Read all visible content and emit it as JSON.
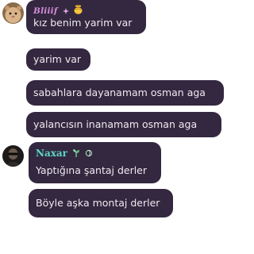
{
  "messages": [
    {
      "sender": "Bliiif",
      "sender_color": "#d88bdc",
      "avatar_icon": "hamster-avatar",
      "badges": [
        "sparkle-icon",
        "honey-pot-icon"
      ],
      "text": "kız benim yarim var"
    },
    {
      "text": "yarim var"
    },
    {
      "text": "sabahlara dayanamam osman aga"
    },
    {
      "text": "yalancısın inanamam osman aga"
    },
    {
      "sender": "Naxar",
      "sender_color": "#5ed6c6",
      "avatar_icon": "dark-portrait-avatar",
      "badges": [
        "plant-icon",
        "leaf-swirl-icon"
      ],
      "text": "Yaptığına şantaj derler"
    },
    {
      "text": "Böyle aşka montaj derler"
    }
  ],
  "colors": {
    "bubble_background": "#33283f",
    "bubble_text": "#eeeaf2",
    "page_background": "#ffffff"
  }
}
